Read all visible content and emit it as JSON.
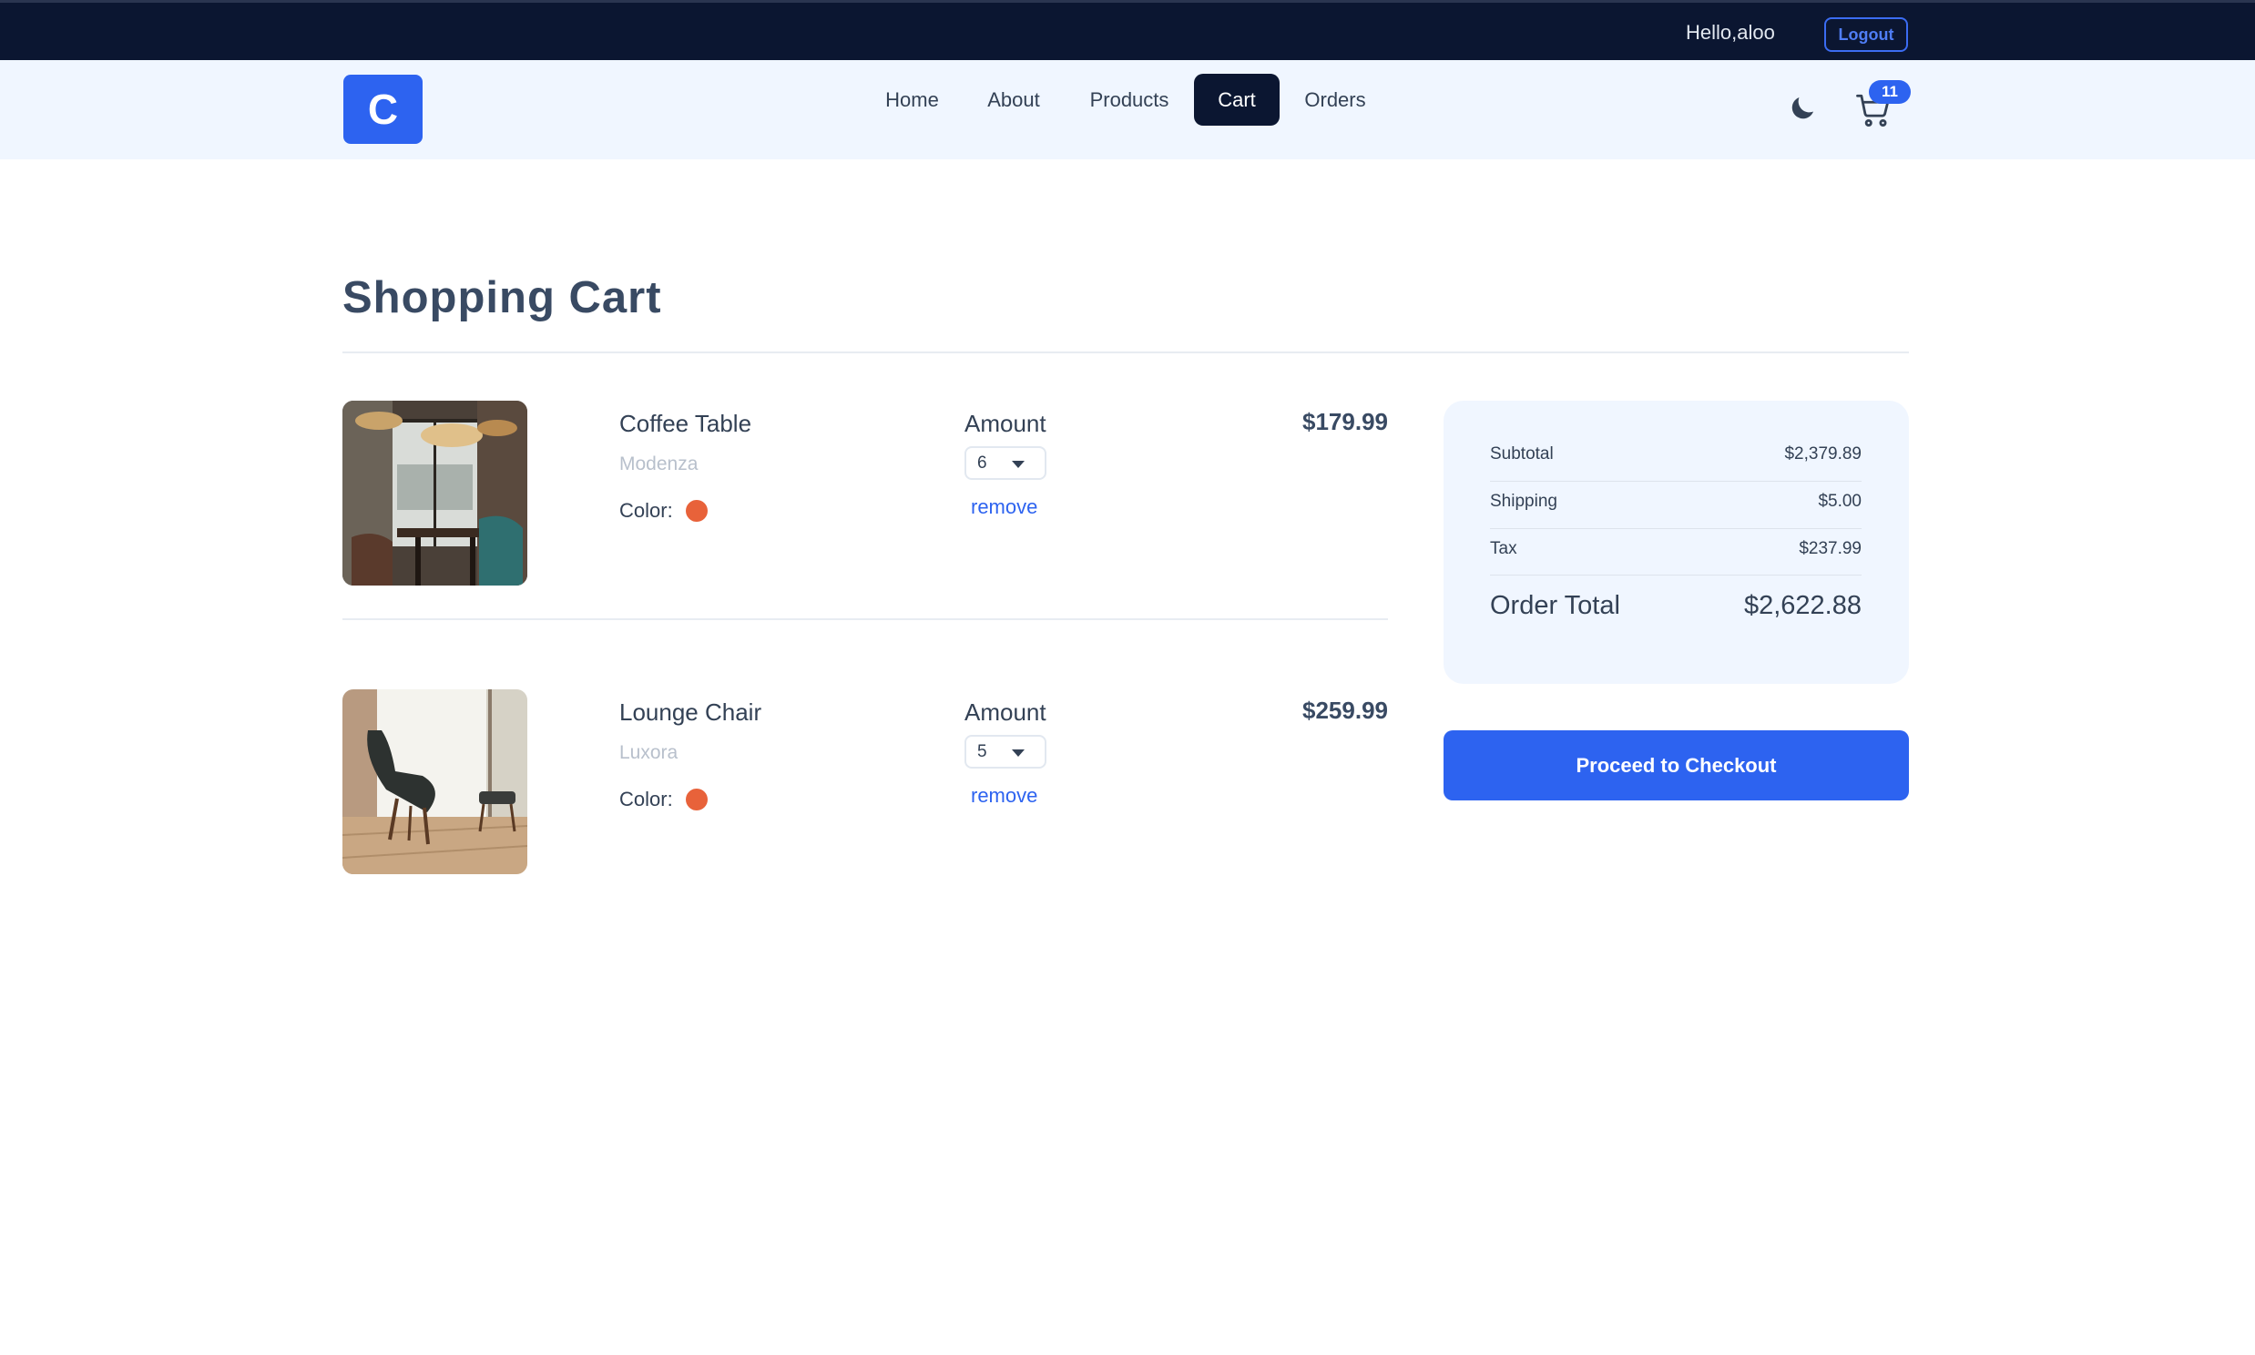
{
  "topbar": {
    "greeting": "Hello,aloo",
    "logout_label": "Logout"
  },
  "navbar": {
    "logo_letter": "C",
    "links": [
      {
        "label": "Home",
        "active": false
      },
      {
        "label": "About",
        "active": false
      },
      {
        "label": "Products",
        "active": false
      },
      {
        "label": "Cart",
        "active": true
      },
      {
        "label": "Orders",
        "active": false
      }
    ],
    "theme_icon": "moon-icon",
    "cart_icon": "shopping-cart-icon",
    "cart_count": "11"
  },
  "page": {
    "title": "Shopping Cart"
  },
  "cart_items": [
    {
      "name": "Coffee Table",
      "company": "Modenza",
      "color_label": "Color:",
      "color": "#e8623a",
      "amount_label": "Amount",
      "amount": "6",
      "remove_label": "remove",
      "price": "$179.99",
      "image": "cafe-interior-photo"
    },
    {
      "name": "Lounge Chair",
      "company": "Luxora",
      "color_label": "Color:",
      "color": "#e8623a",
      "amount_label": "Amount",
      "amount": "5",
      "remove_label": "remove",
      "price": "$259.99",
      "image": "lounge-chair-photo"
    }
  ],
  "summary": {
    "subtotal_label": "Subtotal",
    "subtotal": "$2,379.89",
    "shipping_label": "Shipping",
    "shipping": "$5.00",
    "tax_label": "Tax",
    "tax": "$237.99",
    "total_label": "Order Total",
    "total": "$2,622.88"
  },
  "checkout_label": "Proceed to Checkout",
  "colors": {
    "topbar_bg": "#0b1631",
    "navbar_bg": "#f0f6ff",
    "primary": "#2d63f0",
    "active_nav_bg": "#0b1631",
    "summary_bg": "#f0f6ff"
  }
}
